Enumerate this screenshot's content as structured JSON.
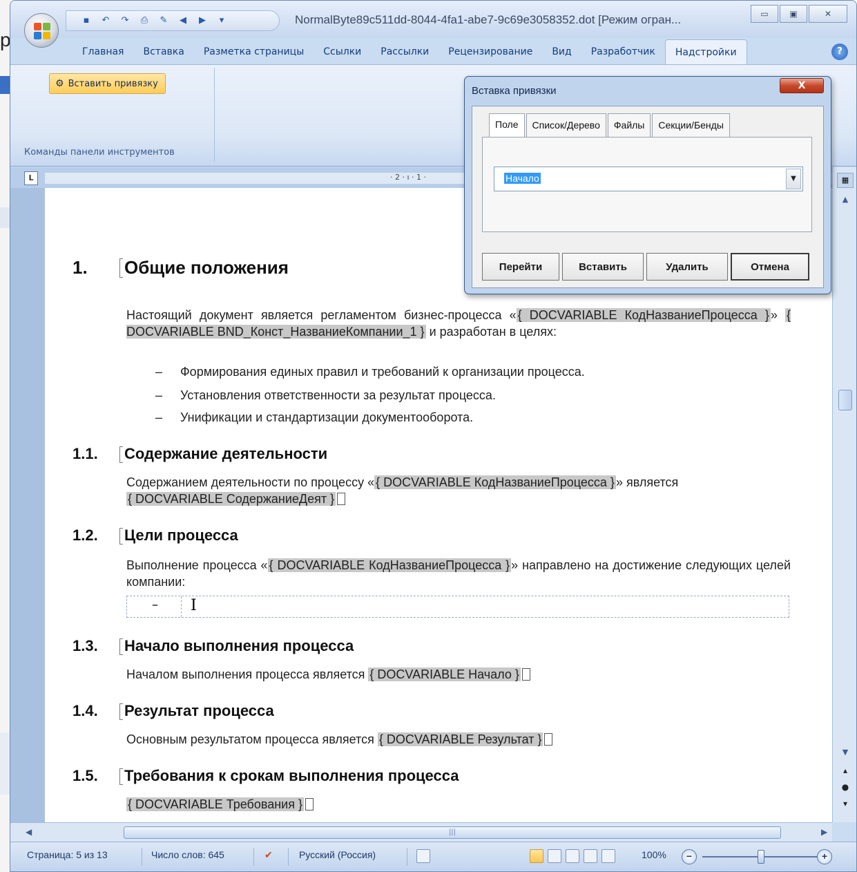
{
  "background": {
    "partial_text": "р"
  },
  "window": {
    "title": "NormalByte89c511dd-8044-4fa1-abe7-9c69e3058352.dot [Режим огран...",
    "controls": {
      "minimize": "▭",
      "maximize": "▣",
      "close": "✕"
    }
  },
  "quick_access": {
    "icons": [
      "save-icon",
      "undo-icon",
      "redo-icon",
      "print-preview-icon",
      "spelling-icon",
      "back-icon",
      "forward-icon",
      "customize-icon"
    ]
  },
  "ribbon": {
    "tabs": [
      {
        "label": "Главная"
      },
      {
        "label": "Вставка"
      },
      {
        "label": "Разметка страницы"
      },
      {
        "label": "Ссылки"
      },
      {
        "label": "Рассылки"
      },
      {
        "label": "Рецензирование"
      },
      {
        "label": "Вид"
      },
      {
        "label": "Разработчик"
      },
      {
        "label": "Надстройки"
      }
    ],
    "active_tab": "Надстройки",
    "insert_binding_label": "Вставить привязку",
    "group_label": "Команды панели инструментов"
  },
  "ruler": {
    "numbers": "· 2 · ı · 1 ·"
  },
  "document": {
    "sections": {
      "s1": {
        "num": "1.",
        "title": "Общие положения"
      },
      "s11": {
        "num": "1.1.",
        "title": "Содержание деятельности"
      },
      "s12": {
        "num": "1.2.",
        "title": "Цели процесса"
      },
      "s13": {
        "num": "1.3.",
        "title": "Начало выполнения процесса"
      },
      "s14": {
        "num": "1.4.",
        "title": "Результат процесса"
      },
      "s15": {
        "num": "1.5.",
        "title": "Требования к срокам выполнения процесса"
      }
    },
    "p1": {
      "t1": "Настоящий документ является регламентом бизнес-процесса «",
      "f1": "{ DOCVARIABLE КодНазваниеПроцесса }",
      "t2": "» ",
      "f2": "{ DOCVARIABLE BND_Конст_НазваниеКомпании_1 }",
      "t3": " и разработан в целях:"
    },
    "bullets": [
      "Формирования единых правил  и требований к организации процесса.",
      "Установления ответственности за результат процесса.",
      "Унификации и стандартизации  документооборота."
    ],
    "bullet_dash": "–",
    "p11": {
      "t1": "Содержанием деятельности по процессу «",
      "f1": "{ DOCVARIABLE КодНазваниеПроцесса }",
      "t2": "» является ",
      "f2": "{ DOCVARIABLE СодержаниеДеят }"
    },
    "p12": {
      "t1": "Выполнение процесса «",
      "f1": "{ DOCVARIABLE КодНазваниеПроцесса }",
      "t2": "» направлено на достижение следующих целей компании:"
    },
    "p13": {
      "t1": "Началом выполнения процесса является ",
      "f1": "{ DOCVARIABLE Начало }"
    },
    "p14": {
      "t1": "Основным результатом процесса является ",
      "f1": "{ DOCVARIABLE Результат }"
    },
    "p15": {
      "f1": "{ DOCVARIABLE Требования }"
    }
  },
  "statusbar": {
    "page": "Страница: 5 из 13",
    "words": "Число слов: 645",
    "language": "Русский (Россия)",
    "zoom": "100%",
    "zoom_level": 0.5
  },
  "dialog": {
    "title": "Вставка привязки",
    "close": "X",
    "tabs": [
      {
        "label": "Поле"
      },
      {
        "label": "Список/Дерево"
      },
      {
        "label": "Файлы"
      },
      {
        "label": "Секции/Бенды"
      }
    ],
    "combo_value": "Начало",
    "buttons": {
      "goto": "Перейти",
      "insert": "Вставить",
      "delete": "Удалить",
      "cancel": "Отмена"
    }
  },
  "colors": {
    "ribbon_blue": "#c9dcf2",
    "field_gray": "#c8c8c8",
    "highlight": "#3399ff",
    "close_red": "#c74a2c"
  }
}
